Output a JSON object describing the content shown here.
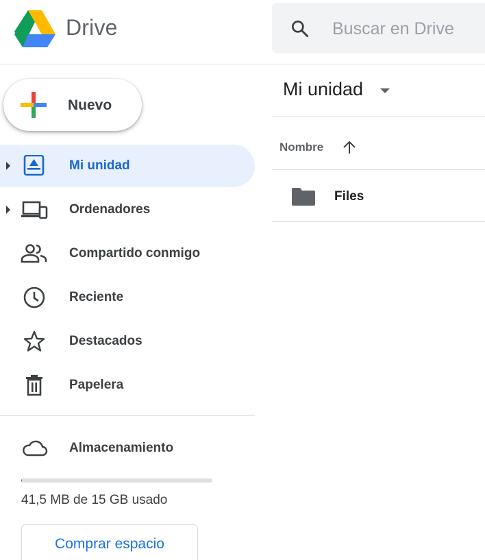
{
  "header": {
    "app_name": "Drive",
    "search": {
      "placeholder": "Buscar en Drive",
      "icon": "search-icon"
    }
  },
  "sidebar": {
    "new_button": {
      "label": "Nuevo",
      "icon": "plus-icon"
    },
    "items": [
      {
        "label": "Mi unidad",
        "icon": "my-drive-icon",
        "active": true,
        "expandable": true
      },
      {
        "label": "Ordenadores",
        "icon": "computers-icon",
        "active": false,
        "expandable": true
      },
      {
        "label": "Compartido conmigo",
        "icon": "shared-with-me-icon",
        "active": false,
        "expandable": false
      },
      {
        "label": "Reciente",
        "icon": "clock-icon",
        "active": false,
        "expandable": false
      },
      {
        "label": "Destacados",
        "icon": "star-icon",
        "active": false,
        "expandable": false
      },
      {
        "label": "Papelera",
        "icon": "trash-icon",
        "active": false,
        "expandable": false
      }
    ],
    "storage": {
      "label": "Almacenamiento",
      "icon": "cloud-icon",
      "usage_text": "41,5 MB de 15 GB usado",
      "used_fraction": 0.003,
      "buy_button": "Comprar espacio"
    }
  },
  "main": {
    "title": "Mi unidad",
    "column_header": "Nombre",
    "sort": "ascending",
    "files": [
      {
        "name": "Files",
        "type": "folder",
        "icon": "folder-icon"
      }
    ]
  },
  "colors": {
    "accent": "#1a73e8",
    "active_bg": "#e8f0fe",
    "active_text": "#1967d2",
    "search_bg": "#f1f3f4",
    "icon_gray": "#5f6368"
  }
}
